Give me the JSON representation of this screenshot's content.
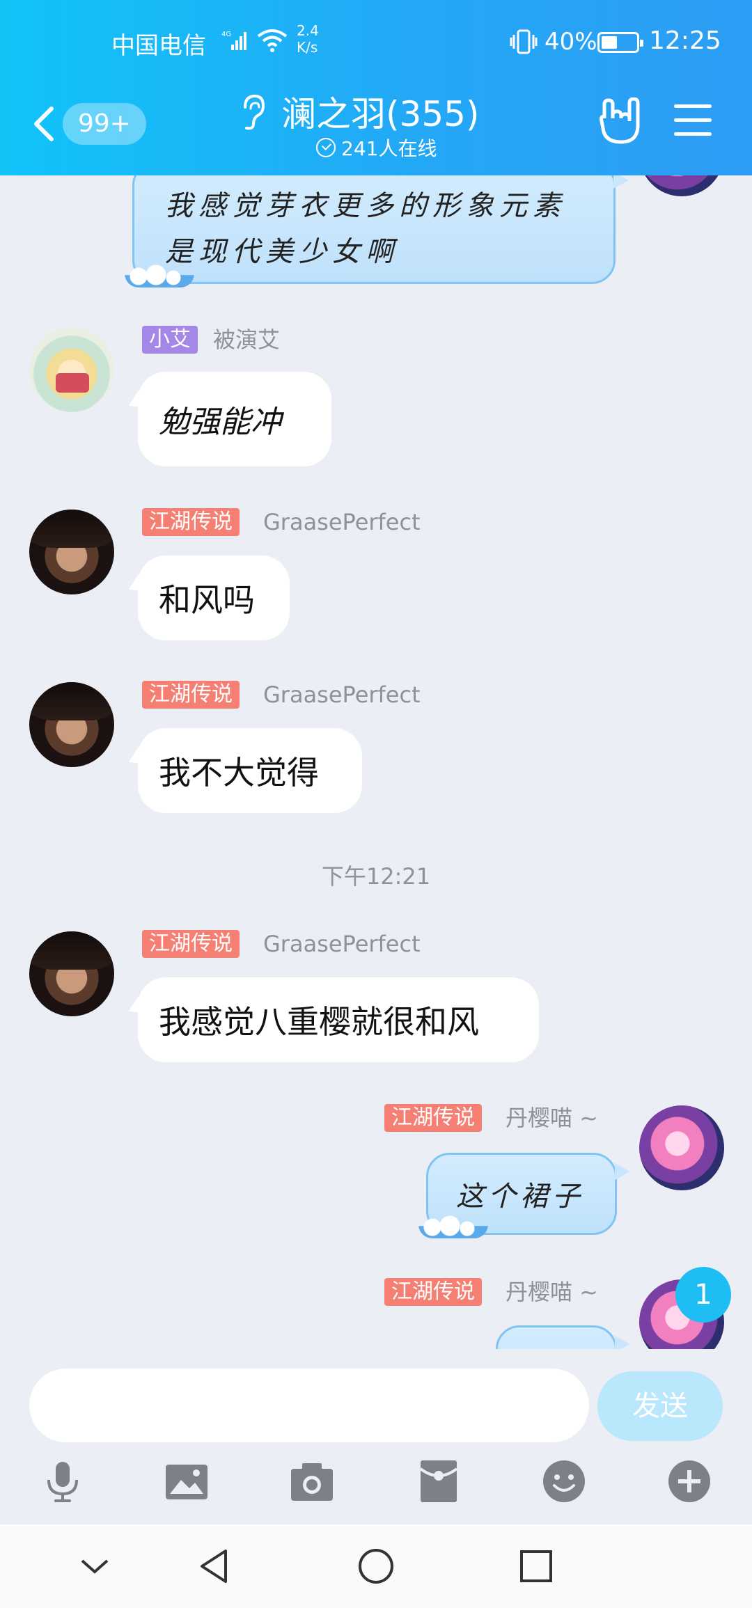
{
  "status_bar": {
    "carrier": "中国电信",
    "network": "4G",
    "speed_value": "2.4",
    "speed_unit": "K/s",
    "battery": "40%",
    "time": "12:25"
  },
  "header": {
    "unread_count": "99+",
    "title": "澜之羽(355)",
    "online": "241人在线",
    "accent_color": "#1fb6f7"
  },
  "messages": [
    {
      "type": "themed",
      "text_line1": "我感觉芽衣更多的形象元素",
      "text_line2": "是现代美少女啊",
      "side": "right"
    },
    {
      "tag": "小艾",
      "tag_color": "#a487e6",
      "nick": "被演艾",
      "text": "勉强能冲"
    },
    {
      "tag": "江湖传说",
      "tag_color": "#f47f72",
      "nick": "GraasePerfect",
      "text": "和风吗"
    },
    {
      "tag": "江湖传说",
      "tag_color": "#f47f72",
      "nick": "GraasePerfect",
      "text": "我不大觉得"
    },
    {
      "tag": "江湖传说",
      "tag_color": "#f47f72",
      "nick": "GraasePerfect",
      "text": "我感觉八重樱就很和风"
    },
    {
      "tag": "江湖传说",
      "tag_color": "#f47f72",
      "nick": "丹樱喵 ~",
      "text": "这个裙子",
      "side": "right"
    },
    {
      "tag": "江湖传说",
      "tag_color": "#f47f72",
      "nick": "丹樱喵 ~",
      "text": "",
      "side": "right"
    }
  ],
  "timestamp": "下午12:21",
  "new_message_badge": "1",
  "input": {
    "placeholder": "",
    "send_label": "发送"
  },
  "toolbar_icons": [
    "microphone-icon",
    "image-icon",
    "camera-icon",
    "red-packet-icon",
    "emoji-icon",
    "plus-icon"
  ],
  "nav_icons": [
    "chevron-down-icon",
    "back-triangle-icon",
    "home-circle-icon",
    "recents-square-icon"
  ]
}
